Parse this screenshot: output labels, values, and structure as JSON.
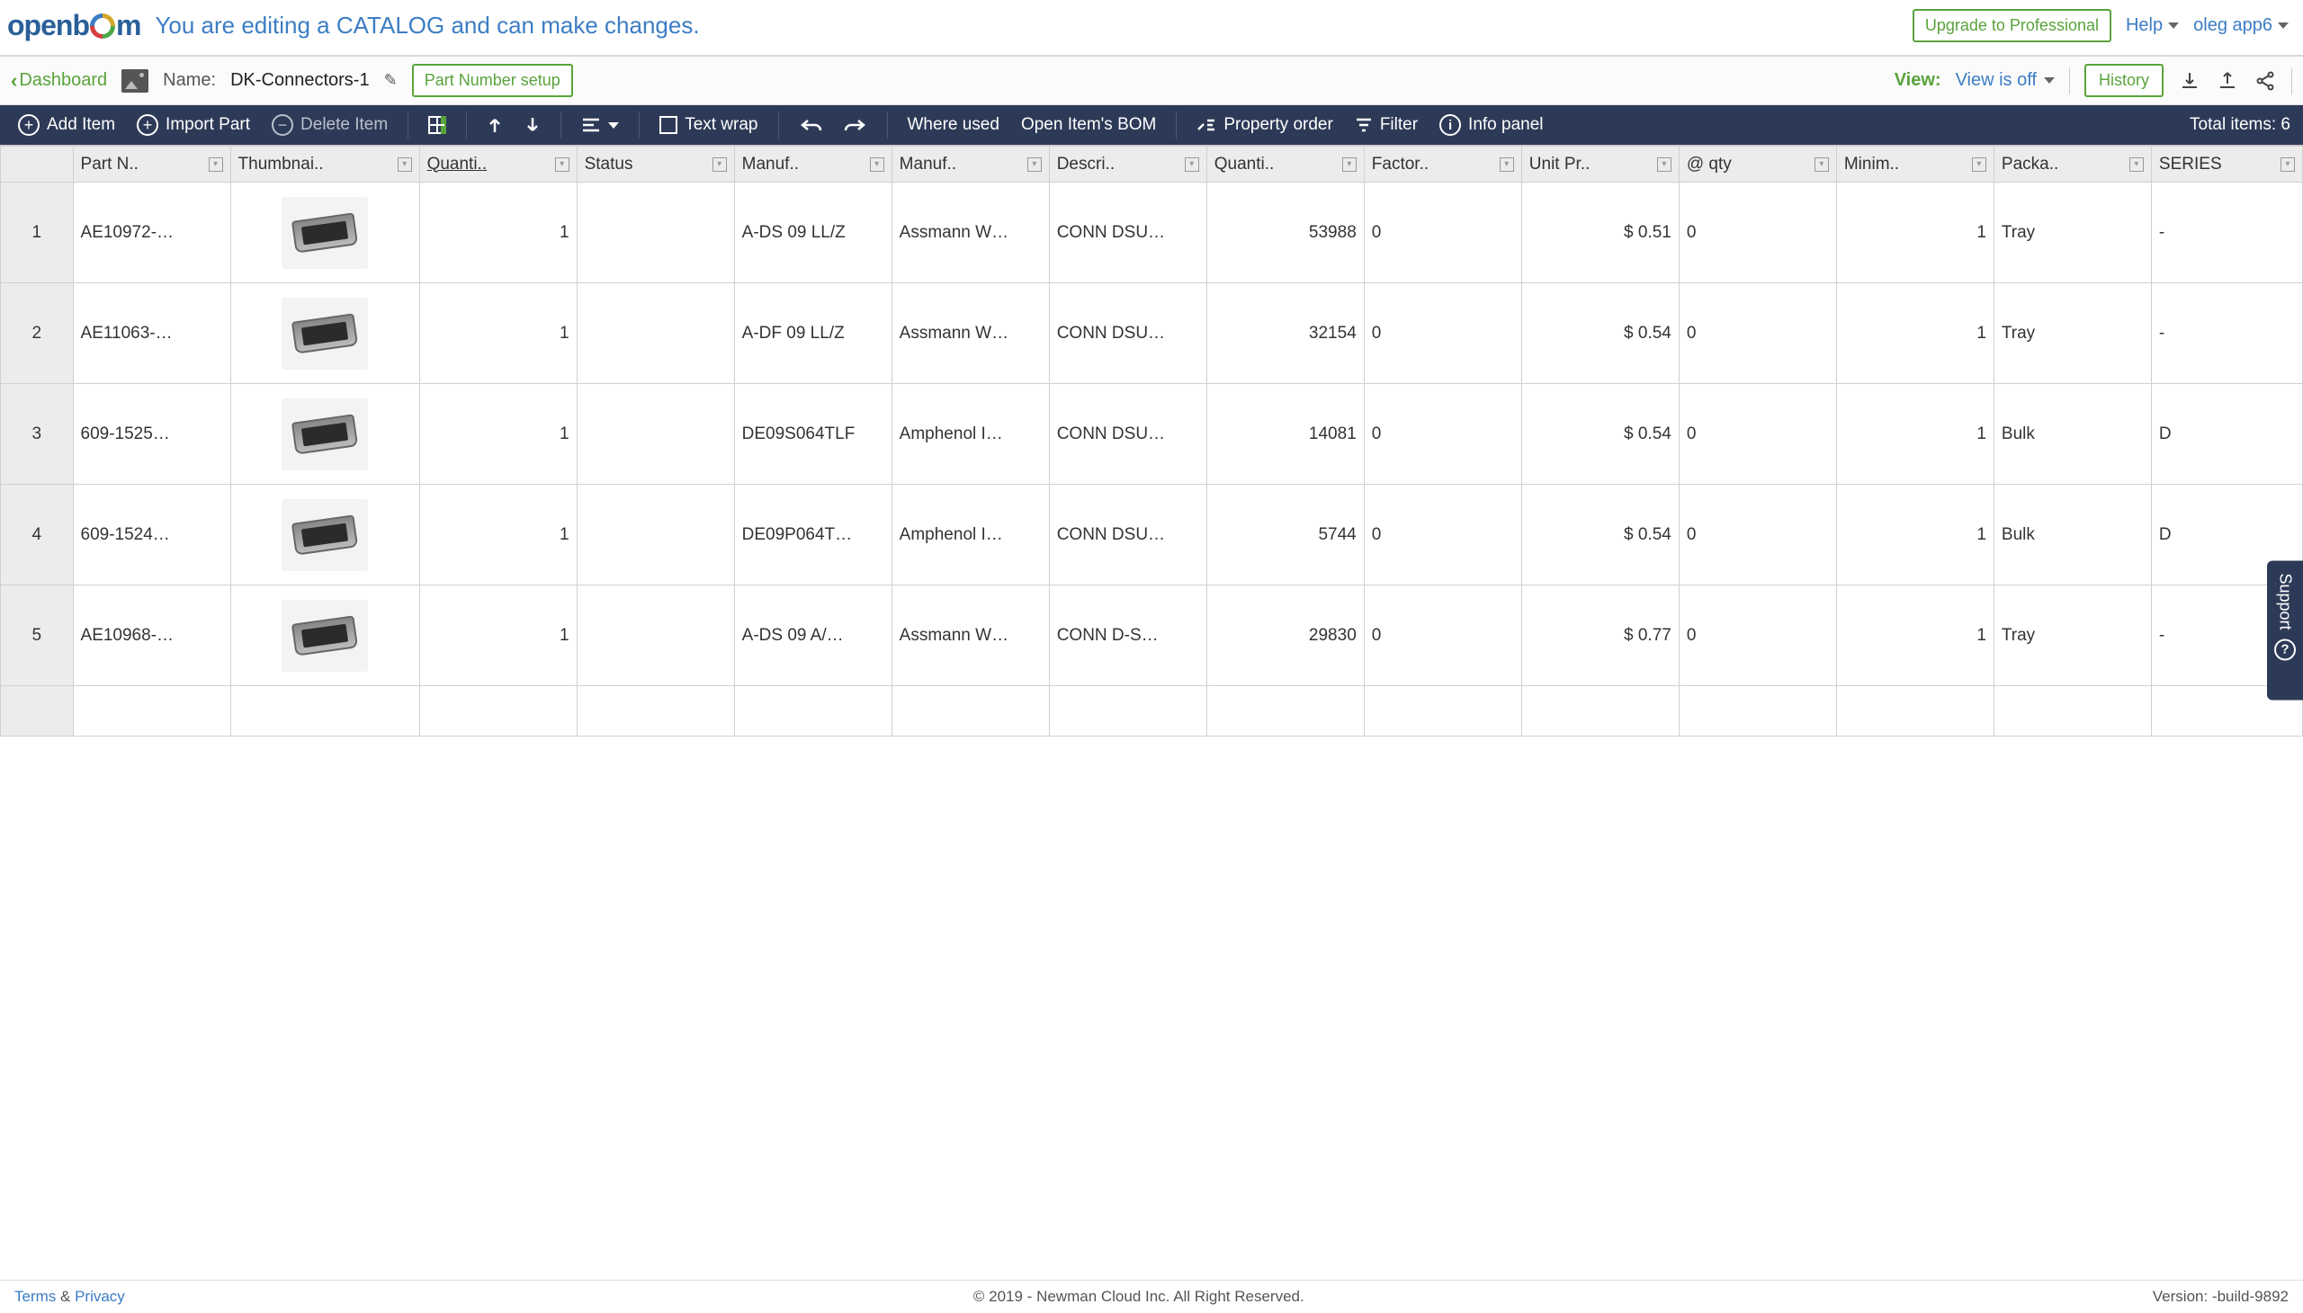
{
  "header": {
    "edit_banner": "You are editing a CATALOG and can make changes.",
    "upgrade_label": "Upgrade to Professional",
    "help_label": "Help",
    "user_label": "oleg app6"
  },
  "subheader": {
    "dashboard_label": "Dashboard",
    "name_label": "Name:",
    "name_value": "DK-Connectors-1",
    "pn_setup_label": "Part Number setup",
    "view_label": "View:",
    "view_value": "View is off",
    "history_label": "History"
  },
  "toolbar": {
    "add_item": "Add Item",
    "import_part": "Import Part",
    "delete_item": "Delete Item",
    "text_wrap": "Text wrap",
    "where_used": "Where used",
    "open_bom": "Open Item's BOM",
    "property_order": "Property order",
    "filter": "Filter",
    "info_panel": "Info panel",
    "total_items_label": "Total items:",
    "total_items_count": "6"
  },
  "columns": {
    "part_number": "Part N..",
    "thumbnail": "Thumbnai..",
    "quantity": "Quanti..",
    "status": "Status",
    "mfr_pn": "Manuf..",
    "mfr": "Manuf..",
    "description": "Descri..",
    "qty_available": "Quanti..",
    "factory": "Factor..",
    "unit_price": "Unit Pr..",
    "at_qty": "@ qty",
    "minimum": "Minim..",
    "packaging": "Packa..",
    "series": "SERIES"
  },
  "rows": [
    {
      "n": "1",
      "part_number": "AE10972-…",
      "quantity": "1",
      "status": "",
      "mfr_pn": "A-DS 09 LL/Z",
      "mfr": "Assmann W…",
      "description": "CONN DSU…",
      "qty_available": "53988",
      "factory": "0",
      "unit_price": "$ 0.51",
      "at_qty": "0",
      "minimum": "1",
      "packaging": "Tray",
      "series": "-"
    },
    {
      "n": "2",
      "part_number": "AE11063-…",
      "quantity": "1",
      "status": "",
      "mfr_pn": "A-DF 09 LL/Z",
      "mfr": "Assmann W…",
      "description": "CONN DSU…",
      "qty_available": "32154",
      "factory": "0",
      "unit_price": "$ 0.54",
      "at_qty": "0",
      "minimum": "1",
      "packaging": "Tray",
      "series": "-"
    },
    {
      "n": "3",
      "part_number": "609-1525…",
      "quantity": "1",
      "status": "",
      "mfr_pn": "DE09S064TLF",
      "mfr": "Amphenol I…",
      "description": "CONN DSU…",
      "qty_available": "14081",
      "factory": "0",
      "unit_price": "$ 0.54",
      "at_qty": "0",
      "minimum": "1",
      "packaging": "Bulk",
      "series": "D"
    },
    {
      "n": "4",
      "part_number": "609-1524…",
      "quantity": "1",
      "status": "",
      "mfr_pn": "DE09P064T…",
      "mfr": "Amphenol I…",
      "description": "CONN DSU…",
      "qty_available": "5744",
      "factory": "0",
      "unit_price": "$ 0.54",
      "at_qty": "0",
      "minimum": "1",
      "packaging": "Bulk",
      "series": "D"
    },
    {
      "n": "5",
      "part_number": "AE10968-…",
      "quantity": "1",
      "status": "",
      "mfr_pn": "A-DS 09 A/…",
      "mfr": "Assmann W…",
      "description": "CONN D-S…",
      "qty_available": "29830",
      "factory": "0",
      "unit_price": "$ 0.77",
      "at_qty": "0",
      "minimum": "1",
      "packaging": "Tray",
      "series": "-"
    },
    {
      "n": "",
      "part_number": "",
      "quantity": "",
      "status": "",
      "mfr_pn": "",
      "mfr": "",
      "description": "",
      "qty_available": "",
      "factory": "",
      "unit_price": "",
      "at_qty": "",
      "minimum": "",
      "packaging": "",
      "series": ""
    }
  ],
  "footer": {
    "terms": "Terms",
    "amp": " & ",
    "privacy": "Privacy",
    "copyright": "© 2019 - Newman Cloud Inc. All Right Reserved.",
    "version": "Version: -build-9892"
  },
  "support_label": "Support"
}
